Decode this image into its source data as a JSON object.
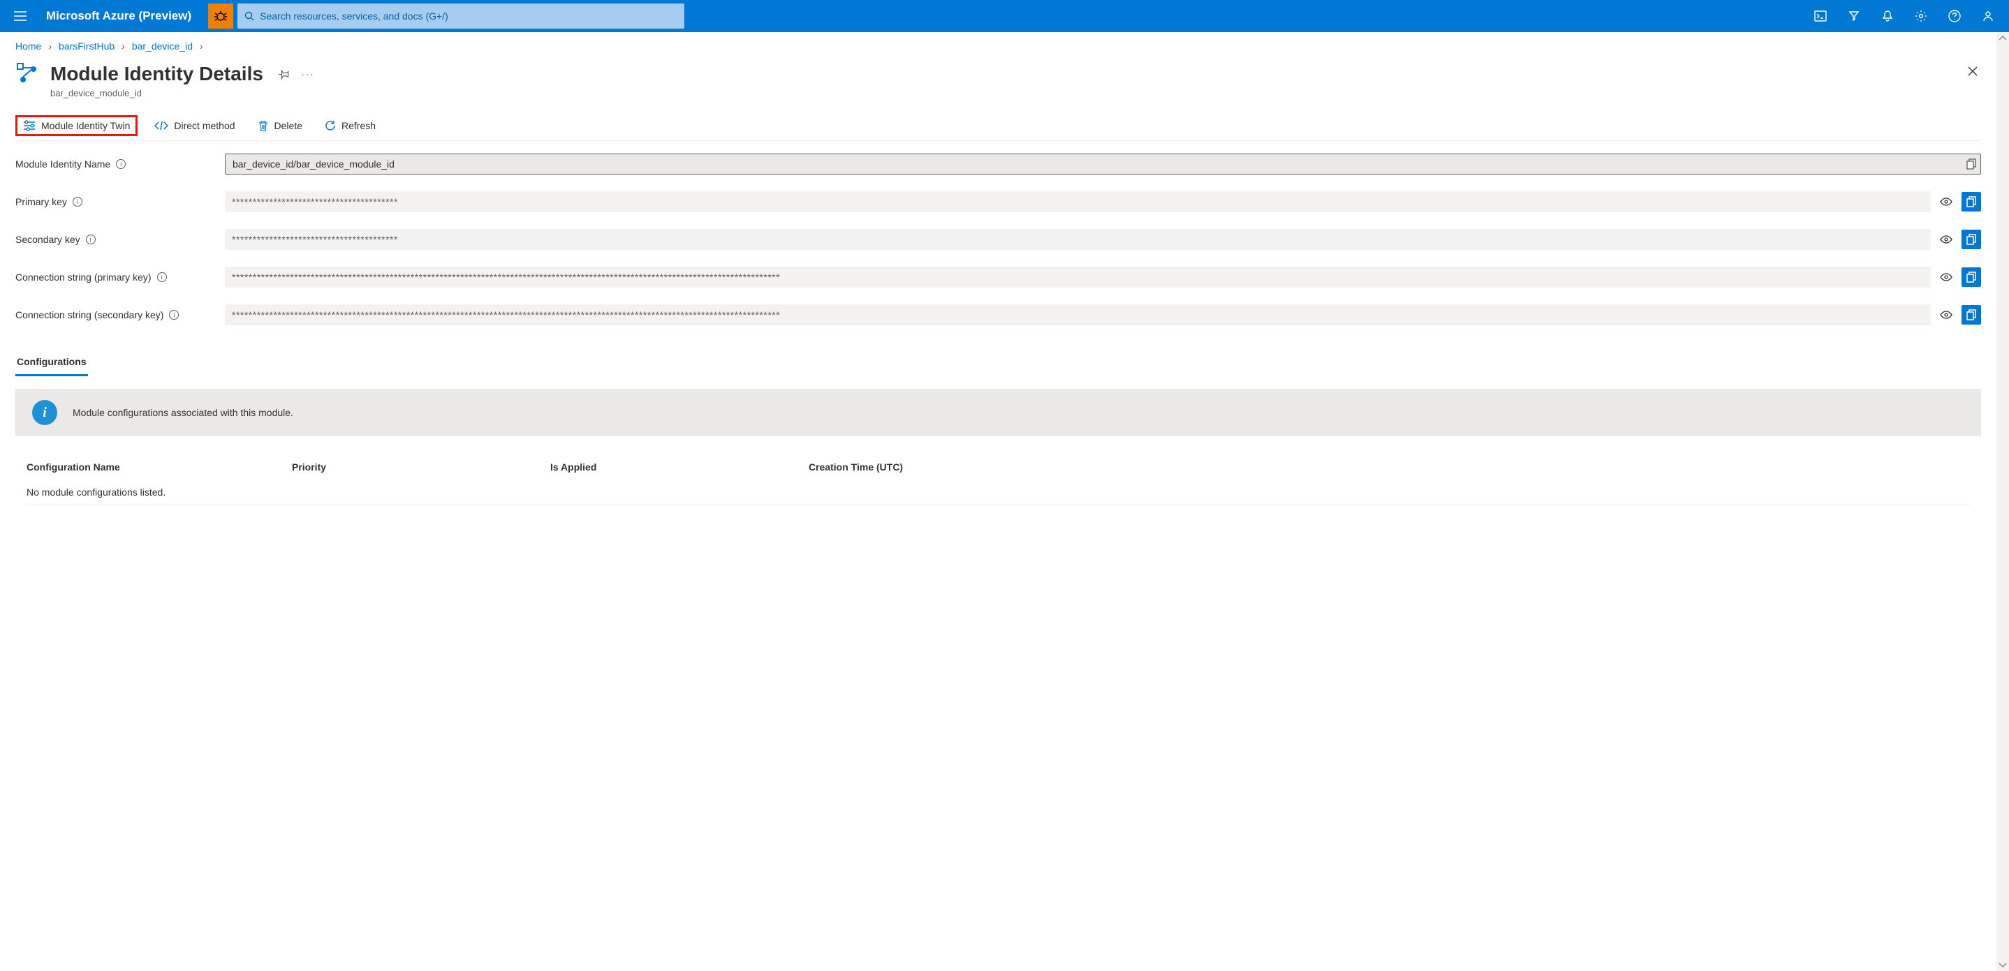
{
  "topbar": {
    "brand": "Microsoft Azure (Preview)",
    "search_placeholder": "Search resources, services, and docs (G+/)"
  },
  "breadcrumbs": {
    "items": [
      "Home",
      "barsFirstHub",
      "bar_device_id"
    ]
  },
  "page": {
    "title": "Module Identity Details",
    "subtitle": "bar_device_module_id"
  },
  "toolbar": {
    "twin_label": "Module Identity Twin",
    "direct_method_label": "Direct method",
    "delete_label": "Delete",
    "refresh_label": "Refresh"
  },
  "fields": {
    "module_name_label": "Module Identity Name",
    "module_name_value": "bar_device_id/bar_device_module_id",
    "primary_key_label": "Primary key",
    "primary_key_value": "****************************************",
    "secondary_key_label": "Secondary key",
    "secondary_key_value": "****************************************",
    "conn_primary_label": "Connection string (primary key)",
    "conn_primary_value": "************************************************************************************************************************************",
    "conn_secondary_label": "Connection string (secondary key)",
    "conn_secondary_value": "************************************************************************************************************************************"
  },
  "section": {
    "tab_label": "Configurations",
    "banner_text": "Module configurations associated with this module."
  },
  "table": {
    "headers": {
      "name": "Configuration Name",
      "priority": "Priority",
      "applied": "Is Applied",
      "time": "Creation Time (UTC)"
    },
    "empty_text": "No module configurations listed."
  }
}
